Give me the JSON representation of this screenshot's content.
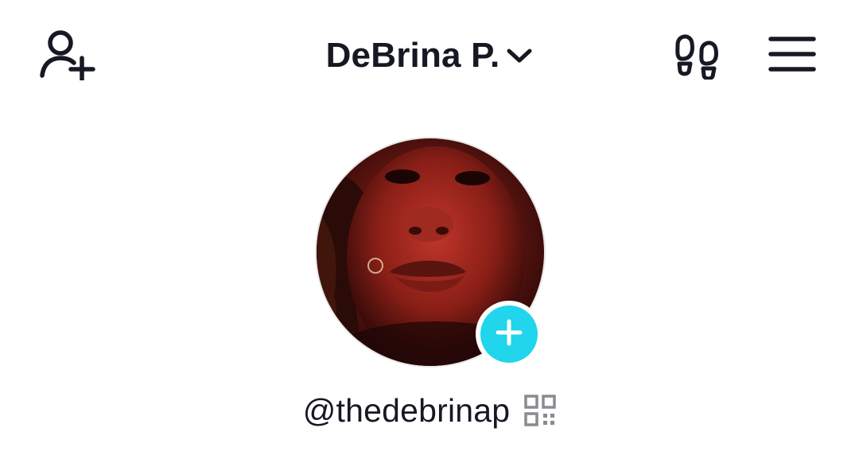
{
  "header": {
    "account_name": "DeBrina P.",
    "icons": {
      "left": "add-friend-icon",
      "account_toggle": "chevron-down-icon",
      "right_1": "footprints-icon",
      "right_2": "hamburger-menu-icon"
    }
  },
  "profile": {
    "username": "@thedebrinap",
    "avatar_badge_icon": "plus-icon",
    "username_icon": "qr-code-icon"
  },
  "colors": {
    "text": "#161823",
    "accent": "#20d5ec",
    "qr_gray": "#8a8b91"
  }
}
